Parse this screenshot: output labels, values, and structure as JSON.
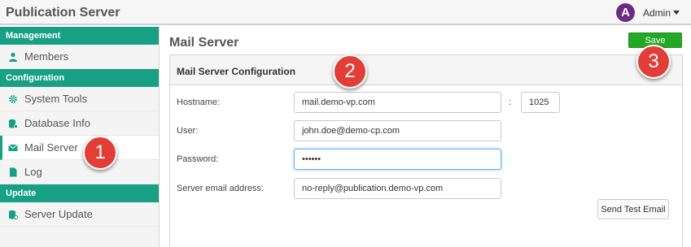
{
  "app": {
    "title": "Publication Server"
  },
  "user": {
    "avatar_letter": "A",
    "name": "Admin",
    "avatar_color": "#6c2a86"
  },
  "colors": {
    "accent": "#17a083",
    "save": "#25a825",
    "callout": "#e03e36"
  },
  "sidebar": {
    "sections": [
      {
        "title": "Management",
        "items": [
          {
            "label": "Members",
            "icon": "user-icon"
          }
        ]
      },
      {
        "title": "Configuration",
        "items": [
          {
            "label": "System Tools",
            "icon": "gear-icon"
          },
          {
            "label": "Database Info",
            "icon": "database-icon"
          },
          {
            "label": "Mail Server",
            "icon": "envelope-icon",
            "active": true
          },
          {
            "label": "Log",
            "icon": "document-icon"
          }
        ]
      },
      {
        "title": "Update",
        "items": [
          {
            "label": "Server Update",
            "icon": "server-update-icon"
          }
        ]
      }
    ]
  },
  "main": {
    "title": "Mail Server",
    "save_label": "Save",
    "panel_title": "Mail Server Configuration",
    "fields": {
      "hostname": {
        "label": "Hostname:",
        "value": "mail.demo-vp.com"
      },
      "port": {
        "label": ":",
        "value": "1025"
      },
      "user": {
        "label": "User:",
        "value": "john.doe@demo-cp.com"
      },
      "password": {
        "label": "Password:",
        "value": "••••••"
      },
      "server_email": {
        "label": "Server email address:",
        "value": "no-reply@publication.demo-vp.com"
      }
    },
    "test_email_label": "Send Test Email"
  },
  "callouts": [
    "1",
    "2",
    "3"
  ]
}
